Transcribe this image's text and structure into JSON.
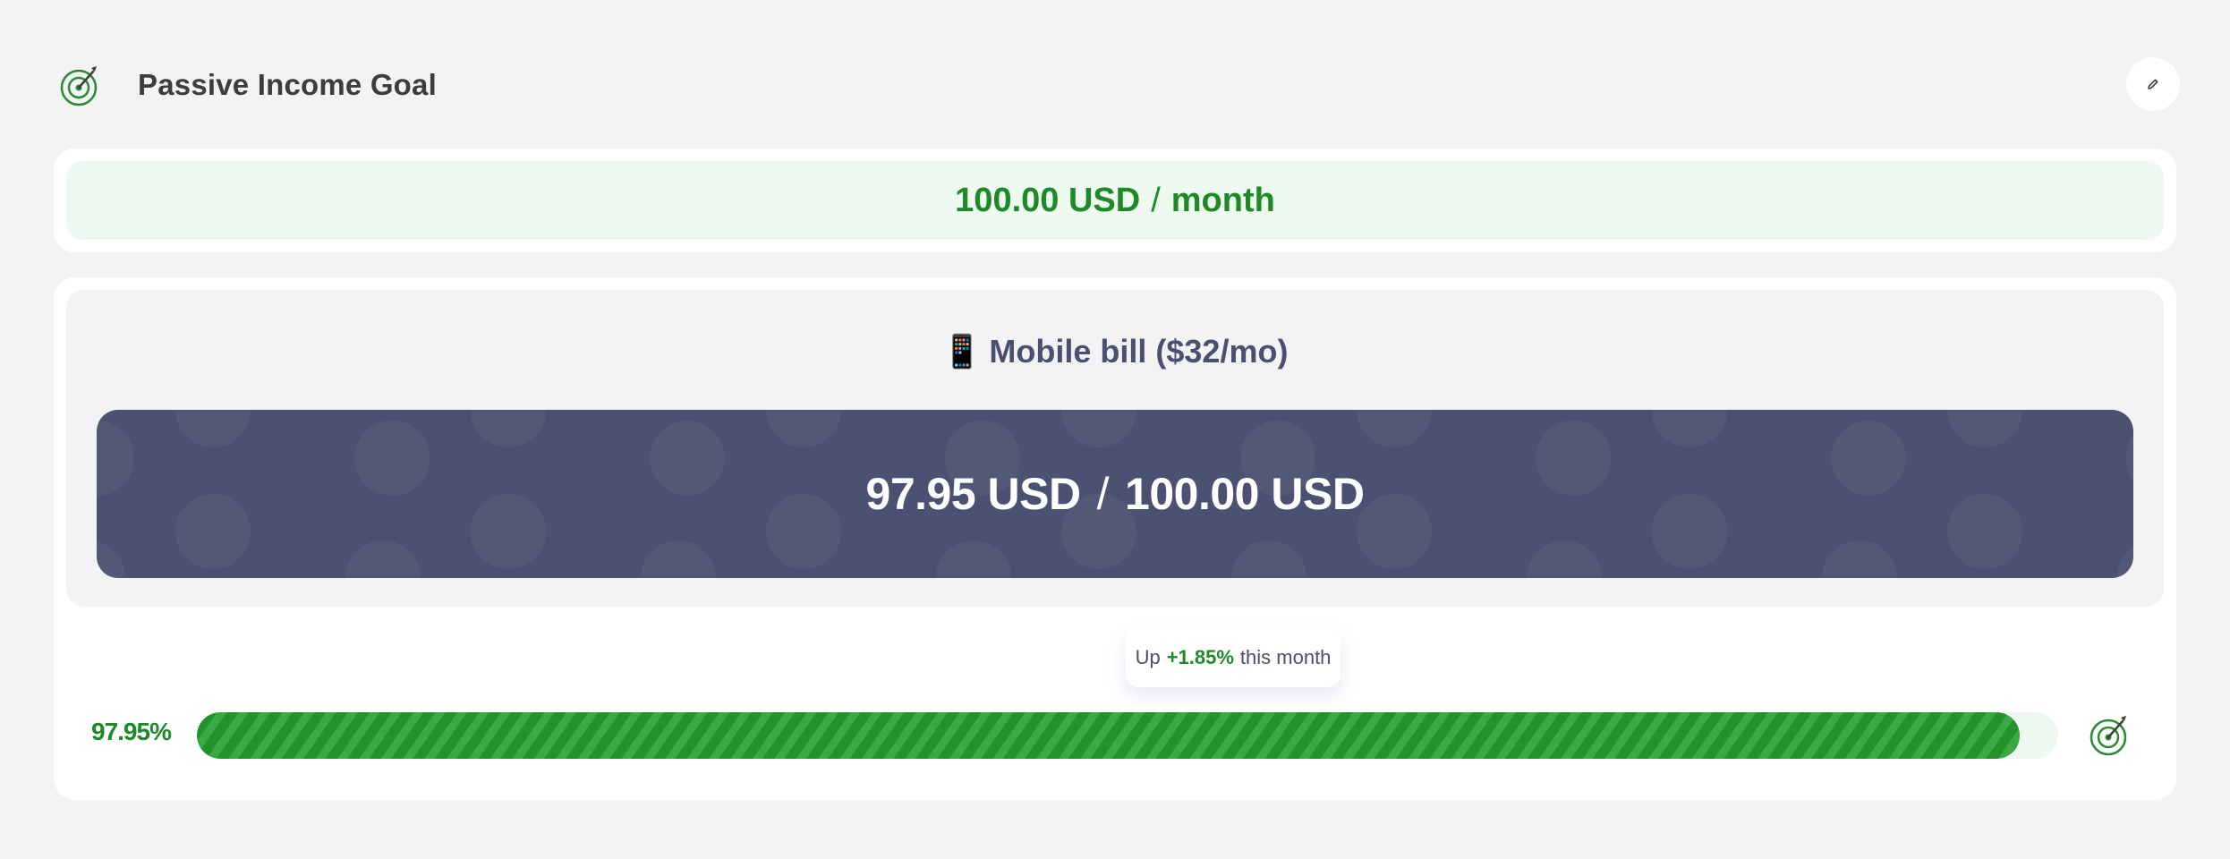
{
  "header": {
    "title": "Passive Income Goal",
    "icon": "target-icon",
    "edit_icon": "pencil-icon"
  },
  "goal": {
    "amount": "100.00 USD",
    "separator": "/",
    "period": "month"
  },
  "milestone": {
    "emoji": "📱",
    "title": "Mobile bill ($32/mo)",
    "current": "97.95 USD",
    "separator": "/",
    "target": "100.00 USD"
  },
  "trend": {
    "prefix": "Up",
    "change": "+1.85%",
    "suffix": "this month"
  },
  "progress": {
    "label": "97.95%",
    "fraction": 0.9795
  },
  "colors": {
    "accent_green": "#1e8a27",
    "light_green": "#eef9ef",
    "slate": "#4b5170",
    "background": "#f3f3f5"
  }
}
